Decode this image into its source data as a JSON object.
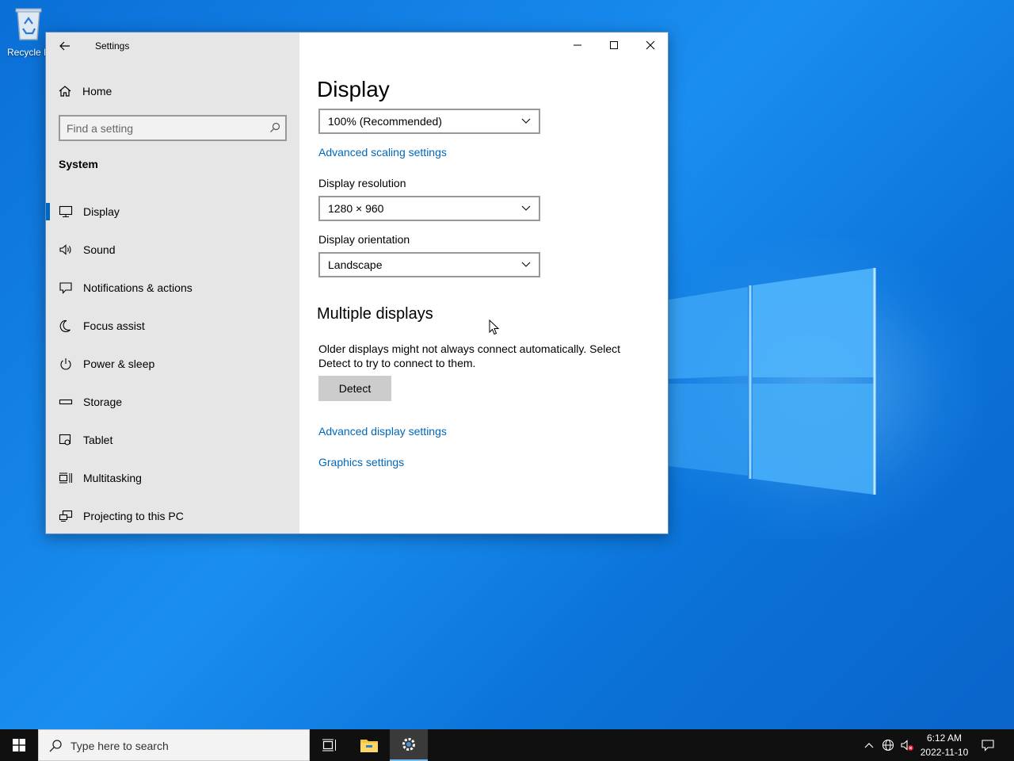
{
  "desktop": {
    "recycle_bin_label": "Recycle B"
  },
  "window": {
    "title": "Settings",
    "controls": {
      "minimize": "minimize-icon",
      "maximize": "maximize-icon",
      "close": "close-icon"
    }
  },
  "sidebar": {
    "home_label": "Home",
    "search_placeholder": "Find a setting",
    "section_title": "System",
    "items": [
      {
        "label": "Display",
        "icon": "monitor-icon",
        "selected": true
      },
      {
        "label": "Sound",
        "icon": "speaker-icon"
      },
      {
        "label": "Notifications & actions",
        "icon": "notification-icon"
      },
      {
        "label": "Focus assist",
        "icon": "moon-icon"
      },
      {
        "label": "Power & sleep",
        "icon": "power-icon"
      },
      {
        "label": "Storage",
        "icon": "storage-icon"
      },
      {
        "label": "Tablet",
        "icon": "tablet-icon"
      },
      {
        "label": "Multitasking",
        "icon": "multitasking-icon"
      },
      {
        "label": "Projecting to this PC",
        "icon": "projecting-icon"
      }
    ]
  },
  "content": {
    "title": "Display",
    "scale_value": "100% (Recommended)",
    "advanced_scaling_link": "Advanced scaling settings",
    "resolution_label": "Display resolution",
    "resolution_value": "1280 × 960",
    "orientation_label": "Display orientation",
    "orientation_value": "Landscape",
    "multiple_displays_title": "Multiple displays",
    "multiple_displays_text": "Older displays might not always connect automatically. Select Detect to try to connect to them.",
    "detect_button": "Detect",
    "advanced_display_link": "Advanced display settings",
    "graphics_link": "Graphics settings"
  },
  "taskbar": {
    "search_placeholder": "Type here to search",
    "time": "6:12 AM",
    "date": "2022-11-10",
    "accent_color": "#76b9ed"
  },
  "colors": {
    "link": "#0067b8",
    "selection_bar": "#0067c0",
    "sidebar_bg": "#e6e6e6"
  }
}
